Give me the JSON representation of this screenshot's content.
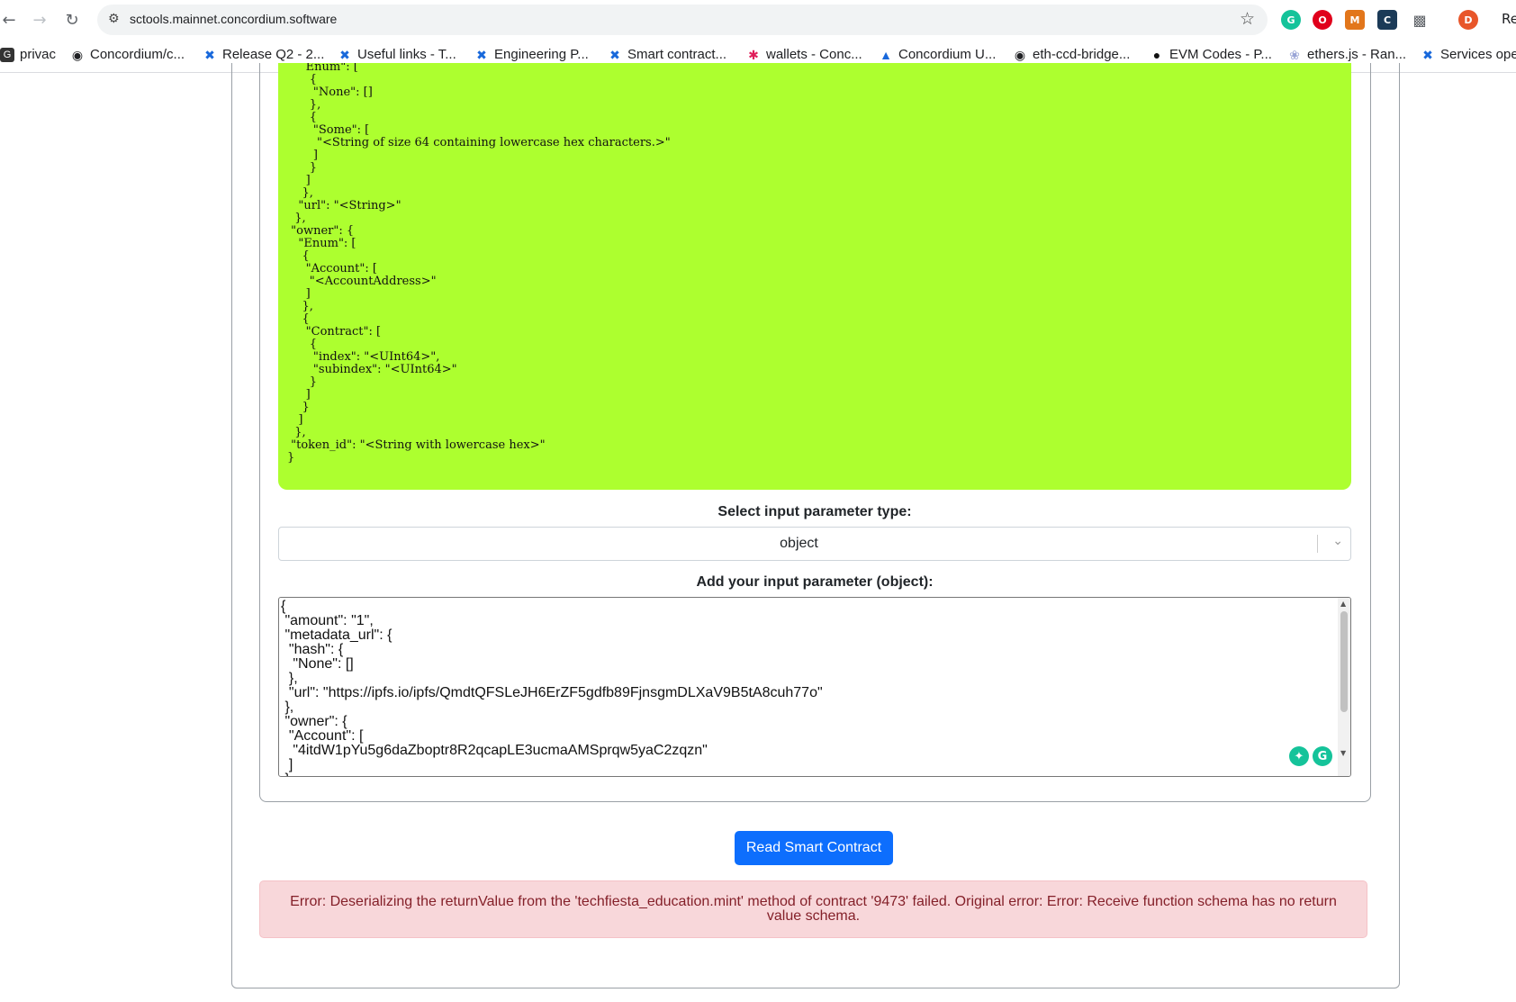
{
  "browser": {
    "url": "sctools.mainnet.concordium.software",
    "tab_partial": "Re",
    "profile_initial": "D",
    "bookmarks": [
      {
        "label": "privac",
        "icon": "coinbase-icon"
      },
      {
        "label": "Concordium/c...",
        "icon": "github-icon"
      },
      {
        "label": "Release Q2 - 2...",
        "icon": "confluence-icon"
      },
      {
        "label": "Useful links - T...",
        "icon": "confluence-icon"
      },
      {
        "label": "Engineering P...",
        "icon": "confluence-icon"
      },
      {
        "label": "Smart contract...",
        "icon": "confluence-icon"
      },
      {
        "label": "wallets - Conc...",
        "icon": "slack-icon"
      },
      {
        "label": "Concordium U...",
        "icon": "atlassian-icon"
      },
      {
        "label": "eth-ccd-bridge...",
        "icon": "github-icon"
      },
      {
        "label": "EVM Codes - P...",
        "icon": "evm-icon"
      },
      {
        "label": "ethers.js - Ran...",
        "icon": "ethers-icon"
      },
      {
        "label": "Services ope",
        "icon": "confluence-icon"
      }
    ]
  },
  "schema_text": "     Enum\": [\n      {\n       \"None\": []\n      },\n      {\n       \"Some\": [\n        \"<String of size 64 containing lowercase hex characters.>\"\n       ]\n      }\n     ]\n    },\n   \"url\": \"<String>\"\n  },\n \"owner\": {\n   \"Enum\": [\n    {\n     \"Account\": [\n      \"<AccountAddress>\"\n     ]\n    },\n    {\n     \"Contract\": [\n      {\n       \"index\": \"<UInt64>\",\n       \"subindex\": \"<UInt64>\"\n      }\n     ]\n    }\n   ]\n  },\n \"token_id\": \"<String with lowercase hex>\"\n}",
  "select_label": "Select input parameter type:",
  "select_value": "object",
  "input_label": "Add your input parameter (object):",
  "input_text": "{\n \"amount\": \"1\",\n \"metadata_url\": {\n  \"hash\": {\n   \"None\": []\n  },\n  \"url\": \"https://ipfs.io/ipfs/QmdtQFSLeJH6ErZF5gdfb89FjnsgmDLXaV9B5tA8cuh77o\"\n },\n \"owner\": {\n  \"Account\": [\n   \"4itdW1pYu5g6daZboptr8R2qcapLE3ucmaAMSprqw5yaC2zqzn\"\n  ]\n },",
  "button_label": "Read Smart Contract",
  "error_text": "Error: Deserializing the returnValue from the 'techfiesta_education.mint' method of contract '9473' failed. Original error: Error: Receive function schema has no return value schema.",
  "colors": {
    "schema_bg": "#adff2f",
    "button": "#0d6efd",
    "error_bg": "#f8d7da",
    "error_text": "#842029"
  }
}
